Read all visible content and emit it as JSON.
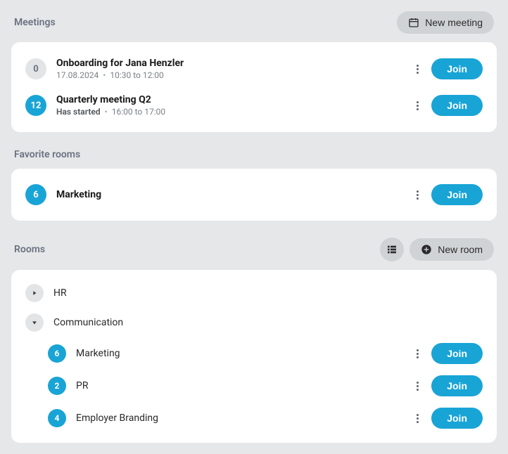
{
  "meetings": {
    "title": "Meetings",
    "new_button": "New meeting",
    "items": [
      {
        "badge": "0",
        "badge_color": "gray",
        "title": "Onboarding for Jana Henzler",
        "date": "17.08.2024",
        "time": "10:30 to 12:00",
        "join_label": "Join"
      },
      {
        "badge": "12",
        "badge_color": "blue",
        "title": "Quarterly meeting Q2",
        "started_label": "Has started",
        "time": "16:00 to 17:00",
        "join_label": "Join"
      }
    ]
  },
  "favorites": {
    "title": "Favorite rooms",
    "items": [
      {
        "badge": "6",
        "name": "Marketing",
        "join_label": "Join"
      }
    ]
  },
  "rooms": {
    "title": "Rooms",
    "new_button": "New room",
    "tree": [
      {
        "name": "HR",
        "expanded": false
      },
      {
        "name": "Communication",
        "expanded": true,
        "children": [
          {
            "badge": "6",
            "name": "Marketing",
            "join_label": "Join"
          },
          {
            "badge": "2",
            "name": "PR",
            "join_label": "Join"
          },
          {
            "badge": "4",
            "name": "Employer Branding",
            "join_label": "Join"
          }
        ]
      }
    ]
  },
  "colors": {
    "accent": "#19a4d6"
  }
}
